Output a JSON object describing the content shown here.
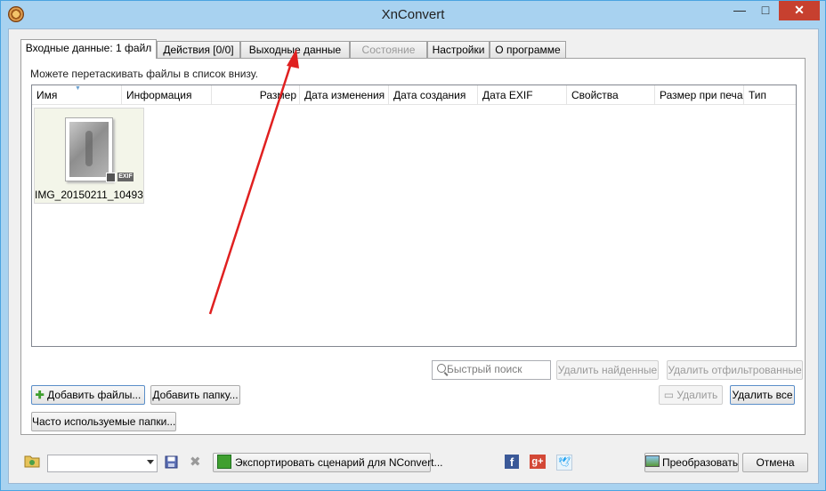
{
  "window": {
    "title": "XnConvert",
    "controls": {
      "minimize": "—",
      "maximize": "□",
      "close": "✕"
    }
  },
  "tabs": [
    {
      "label": "Входные данные: 1 файл",
      "state": "active"
    },
    {
      "label": "Действия [0/0]",
      "state": "normal"
    },
    {
      "label": "Выходные данные",
      "state": "normal"
    },
    {
      "label": "Состояние",
      "state": "disabled"
    },
    {
      "label": "Настройки",
      "state": "normal"
    },
    {
      "label": "О программе",
      "state": "normal"
    }
  ],
  "input": {
    "hint": "Можете перетаскивать файлы в список внизу.",
    "columns": [
      "Имя",
      "Информация",
      "Размер",
      "Дата изменения",
      "Дата создания",
      "Дата EXIF",
      "Свойства",
      "Размер при печа",
      "Тип"
    ],
    "files": [
      {
        "name": "IMG_20150211_10493...",
        "badge": "EXIF"
      }
    ],
    "search_placeholder": "Быстрый поиск",
    "buttons": {
      "remove_found": "Удалить найденные",
      "remove_filtered": "Удалить отфильтрованные",
      "add_files": "Добавить файлы...",
      "add_folder": "Добавить папку...",
      "remove": "Удалить",
      "remove_all": "Удалить все",
      "frequent_folders": "Часто используемые папки..."
    }
  },
  "bottom_bar": {
    "preset_value": "",
    "export_label": "Экспортировать сценарий для NConvert...",
    "convert_label": "Преобразовать",
    "cancel_label": "Отмена"
  },
  "annotation": {
    "color": "#e02020"
  },
  "colors": {
    "titlebar": "#a8d2f0",
    "close_button": "#c7402f",
    "facebook": "#3b5998",
    "google_plus": "#d34836",
    "twitter": "#1da1f2"
  },
  "icons": [
    "app-icon",
    "plus-icon",
    "search-icon",
    "remove-icon",
    "folder-icon",
    "save-icon",
    "delete-icon",
    "export-icon",
    "facebook-icon",
    "google-plus-icon",
    "twitter-icon",
    "convert-icon"
  ]
}
